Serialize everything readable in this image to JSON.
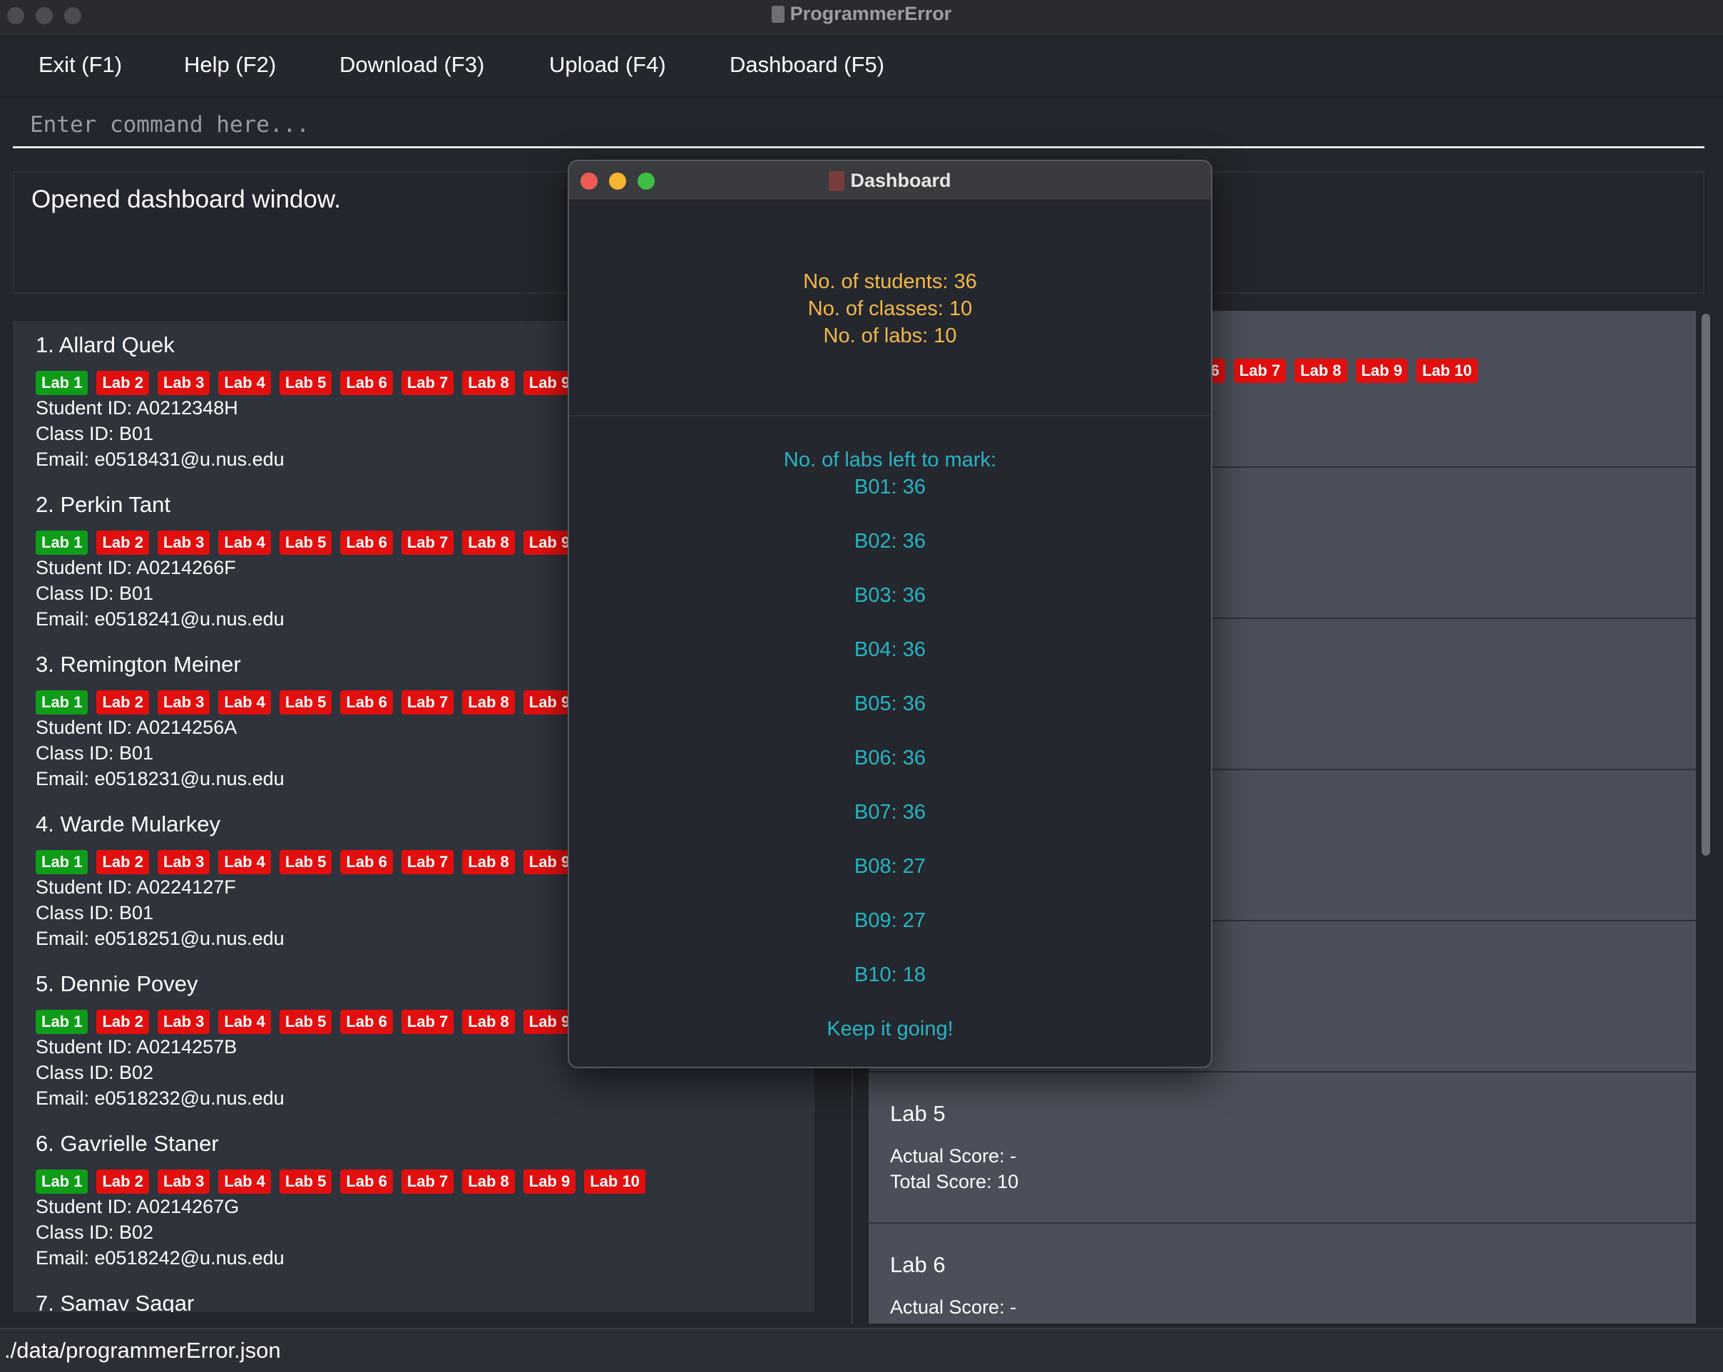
{
  "window": {
    "title": "ProgrammerError"
  },
  "menu": [
    {
      "label": "Exit (F1)"
    },
    {
      "label": "Help (F2)"
    },
    {
      "label": "Download (F3)"
    },
    {
      "label": "Upload (F4)"
    },
    {
      "label": "Dashboard (F5)"
    }
  ],
  "command": {
    "placeholder": "Enter command here..."
  },
  "result": {
    "text": "Opened dashboard window."
  },
  "students": [
    {
      "name": "1.  Allard Quek",
      "labs": [
        "Lab 1",
        "Lab 2",
        "Lab 3",
        "Lab 4",
        "Lab 5",
        "Lab 6",
        "Lab 7",
        "Lab 8",
        "Lab 9"
      ],
      "student_id": "Student ID: A0212348H",
      "class_id": "Class ID: B01",
      "email": "Email: e0518431@u.nus.edu"
    },
    {
      "name": "2.  Perkin Tant",
      "labs": [
        "Lab 1",
        "Lab 2",
        "Lab 3",
        "Lab 4",
        "Lab 5",
        "Lab 6",
        "Lab 7",
        "Lab 8",
        "Lab 9"
      ],
      "student_id": "Student ID: A0214266F",
      "class_id": "Class ID: B01",
      "email": "Email: e0518241@u.nus.edu"
    },
    {
      "name": "3.  Remington Meiner",
      "labs": [
        "Lab 1",
        "Lab 2",
        "Lab 3",
        "Lab 4",
        "Lab 5",
        "Lab 6",
        "Lab 7",
        "Lab 8",
        "Lab 9"
      ],
      "student_id": "Student ID: A0214256A",
      "class_id": "Class ID: B01",
      "email": "Email: e0518231@u.nus.edu"
    },
    {
      "name": "4.  Warde Mularkey",
      "labs": [
        "Lab 1",
        "Lab 2",
        "Lab 3",
        "Lab 4",
        "Lab 5",
        "Lab 6",
        "Lab 7",
        "Lab 8",
        "Lab 9"
      ],
      "student_id": "Student ID: A0224127F",
      "class_id": "Class ID: B01",
      "email": "Email: e0518251@u.nus.edu"
    },
    {
      "name": "5.  Dennie Povey",
      "labs": [
        "Lab 1",
        "Lab 2",
        "Lab 3",
        "Lab 4",
        "Lab 5",
        "Lab 6",
        "Lab 7",
        "Lab 8",
        "Lab 9"
      ],
      "student_id": "Student ID: A0214257B",
      "class_id": "Class ID: B02",
      "email": "Email: e0518232@u.nus.edu"
    },
    {
      "name": "6.  Gavrielle Staner",
      "labs": [
        "Lab 1",
        "Lab 2",
        "Lab 3",
        "Lab 4",
        "Lab 5",
        "Lab 6",
        "Lab 7",
        "Lab 8",
        "Lab 9",
        "Lab 10"
      ],
      "student_id": "Student ID: A0214267G",
      "class_id": "Class ID: B02",
      "email": "Email: e0518242@u.nus.edu"
    },
    {
      "name": "7.  Samav Sagar",
      "labs": [],
      "student_id": "",
      "class_id": "",
      "email": ""
    }
  ],
  "lab_panel": {
    "header_tags": [
      "b 6",
      "Lab 7",
      "Lab 8",
      "Lab 9",
      "Lab 10"
    ],
    "cards": [
      {
        "title": "Lab 5",
        "actual": "Actual Score: -",
        "total": "Total Score: 10"
      },
      {
        "title": "Lab 6",
        "actual": "Actual Score: -",
        "total": ""
      }
    ]
  },
  "dashboard": {
    "title": "Dashboard",
    "summary": [
      "No. of students: 36",
      "No. of classes: 10",
      "No. of labs: 10"
    ],
    "labs_left_title": "No. of labs left to mark:",
    "labs_left": [
      "B01: 36",
      "B02: 36",
      "B03: 36",
      "B04: 36",
      "B05: 36",
      "B06: 36",
      "B07: 36",
      "B08: 27",
      "B09: 27",
      "B10: 18"
    ],
    "footer": "Keep it going!"
  },
  "status": {
    "path": "./data/programmerError.json"
  },
  "colors": {
    "tag_done": "#0f9d19",
    "tag_todo": "#e20f0f",
    "summary": "#f2b84a",
    "labs_left": "#27b4c4"
  }
}
